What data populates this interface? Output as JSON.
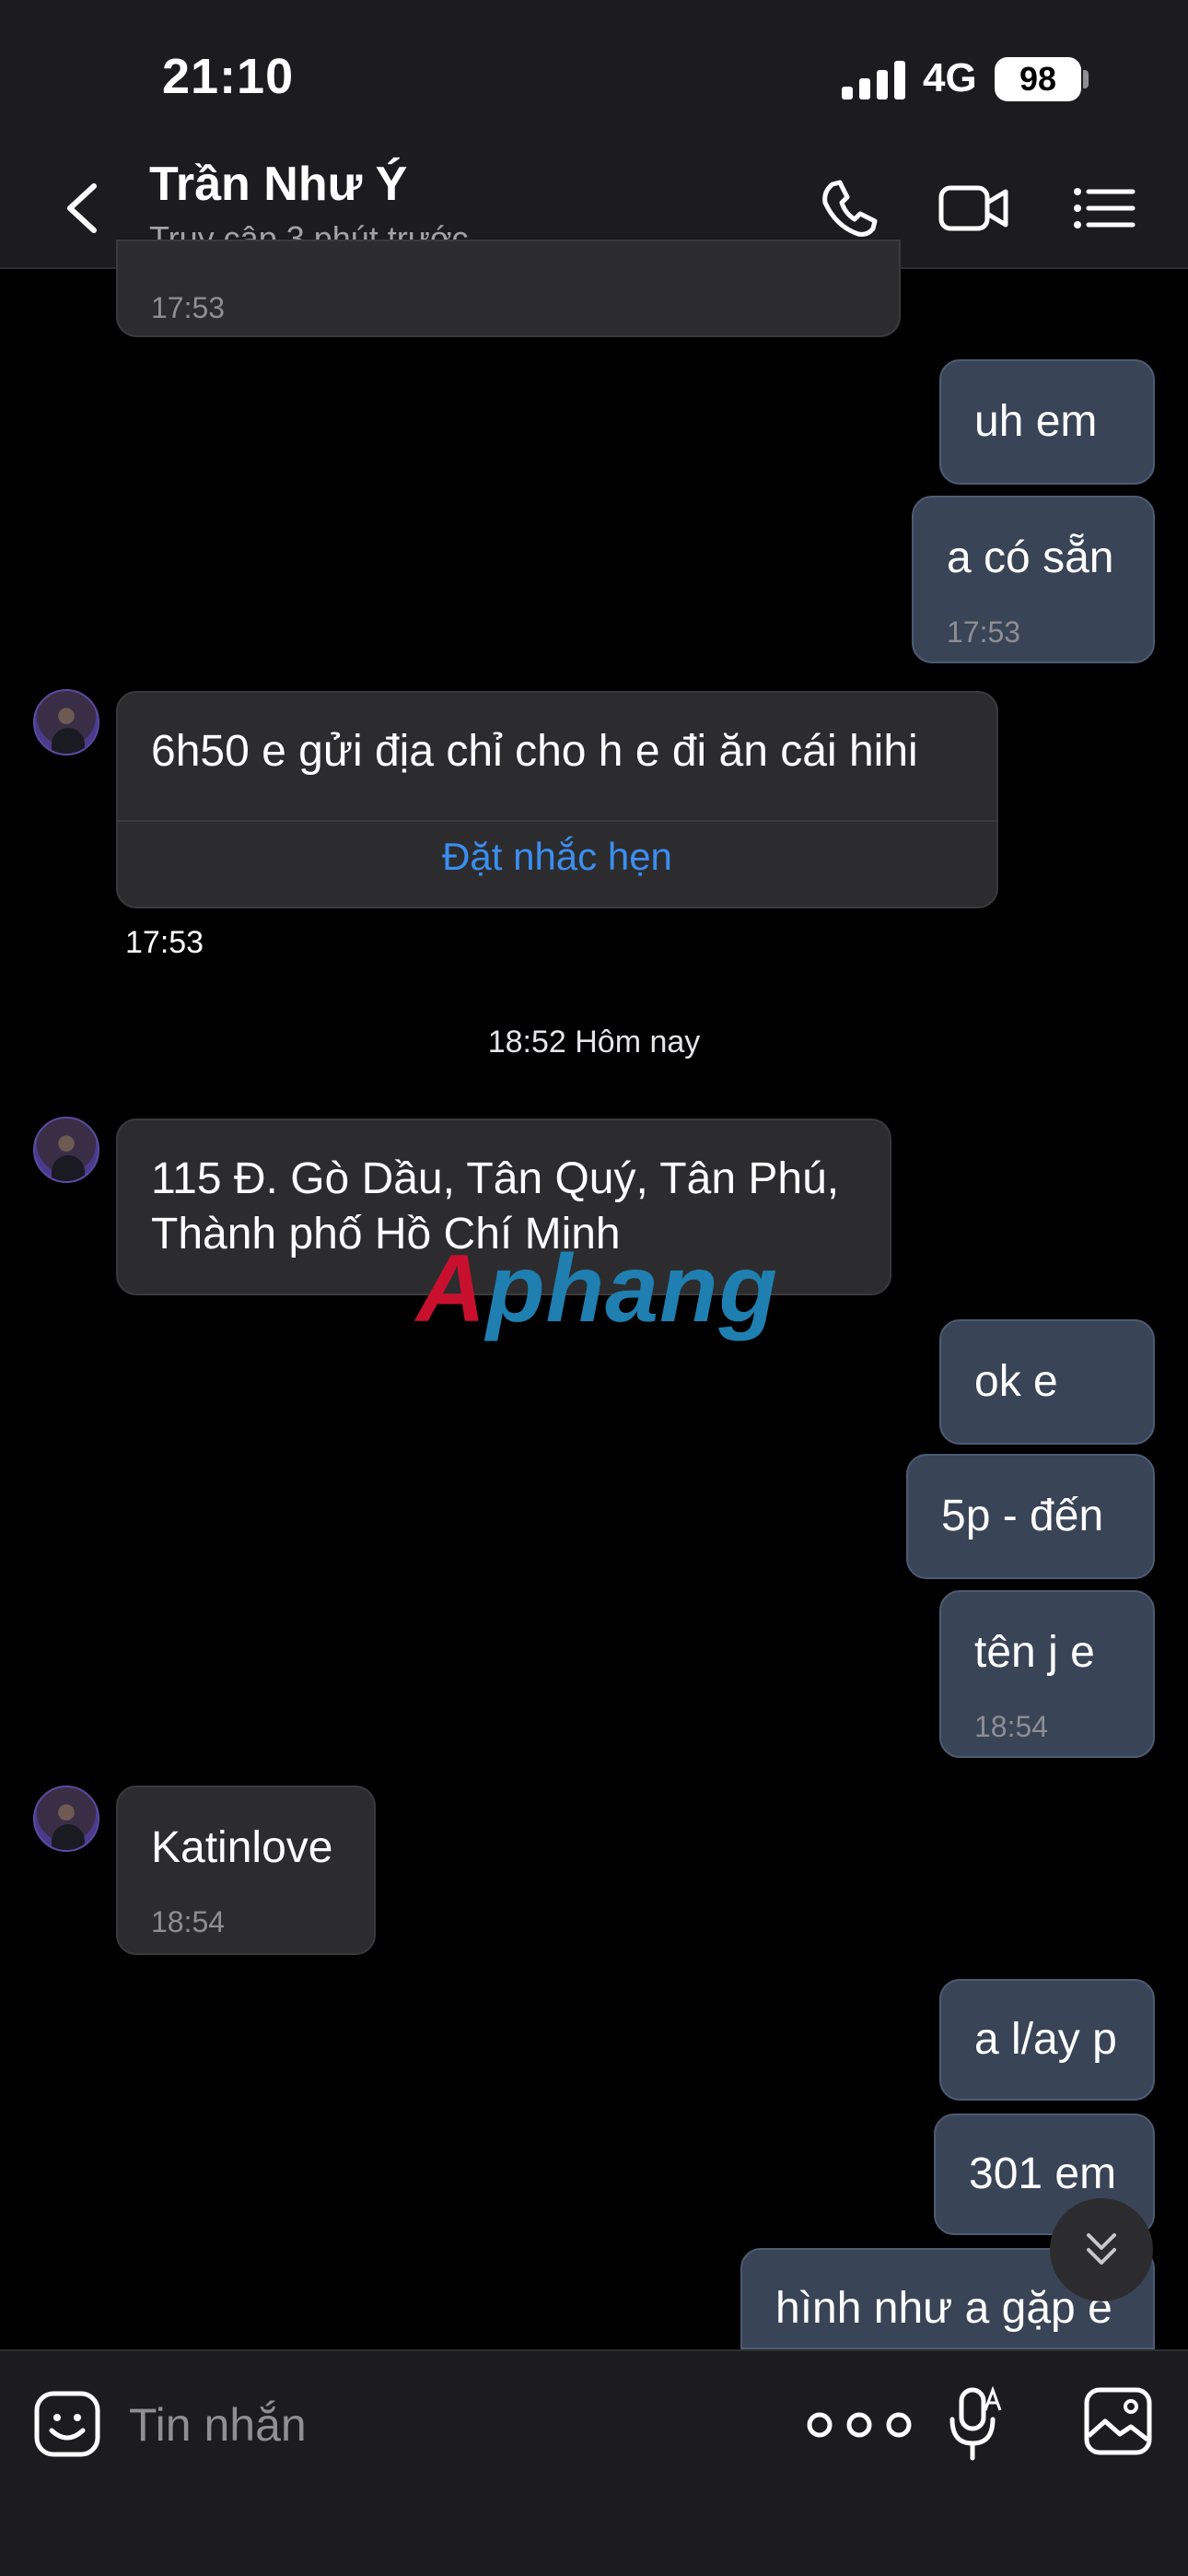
{
  "status_bar": {
    "time": "21:10",
    "network": "4G",
    "battery": "98"
  },
  "header": {
    "name": "Trần Như Ý",
    "status": "Truy cập 3 phút trước"
  },
  "messages": [
    {
      "from": "them",
      "text": "",
      "time": "17:53"
    },
    {
      "from": "me",
      "text": "uh em",
      "time": ""
    },
    {
      "from": "me",
      "text": "a có sẵn",
      "time": "17:53"
    },
    {
      "from": "them",
      "text": "6h50 e gửi địa chỉ cho h e đi ăn cái hihi",
      "action": "Đặt nhắc hẹn",
      "time": "17:53"
    },
    {
      "from": "them",
      "text_line1": "115 Đ. Gò Dầu, Tân Quý, Tân Phú,",
      "text_line2": "Thành phố Hồ Chí Minh"
    },
    {
      "from": "me",
      "text": "ok e"
    },
    {
      "from": "me",
      "text": "5p - đến"
    },
    {
      "from": "me",
      "text": "tên j e",
      "time": "18:54"
    },
    {
      "from": "them",
      "text": "Katinlove",
      "time": "18:54"
    },
    {
      "from": "me",
      "text": "a l/ay p"
    },
    {
      "from": "me",
      "text": "301 em"
    },
    {
      "from": "me",
      "text": "hình như a gặp e"
    }
  ],
  "date_separator": "18:52 Hôm nay",
  "watermark": {
    "first": "A",
    "rest": "phang"
  },
  "input": {
    "placeholder": "Tin nhắn"
  },
  "colors": {
    "accent": "#3b8ef0",
    "my_bubble": "#394457",
    "their_bubble": "#2c2c2e"
  }
}
